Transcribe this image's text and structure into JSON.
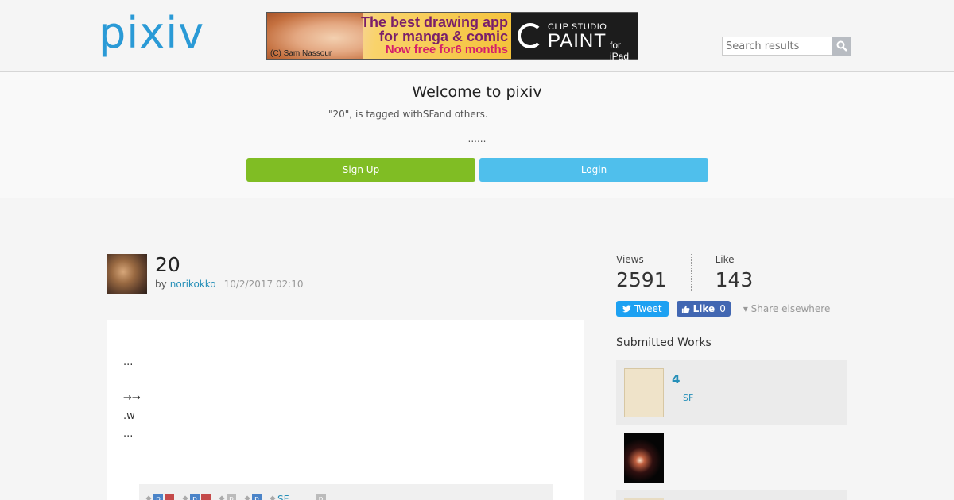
{
  "header": {
    "logo": "pixiv",
    "search": {
      "placeholder": "Search results"
    }
  },
  "ad": {
    "line1": "The best drawing app",
    "line2": "for manga & comic",
    "line3": "Now free for6 months",
    "credit": "(C) Sam Nassour",
    "brand_small": "CLIP STUDIO",
    "brand_big": "PAINT",
    "brand_for": "for iPad"
  },
  "welcome": {
    "title": "Welcome to pixiv",
    "description": "\"20\", is tagged withSFand others.",
    "dots": "......",
    "signup_label": "Sign Up",
    "login_label": "Login"
  },
  "work": {
    "title": "20",
    "by": "by",
    "author": "norikokko",
    "date": "10/2/2017 02:10",
    "caption": [
      "...",
      "",
      "→→",
      ".w",
      "..."
    ],
    "tags": [
      {
        "kind": "pixiv-red"
      },
      {
        "kind": "pixiv-red"
      },
      {
        "kind": "grey"
      },
      {
        "kind": "pixiv"
      },
      {
        "label": "SF"
      },
      {
        "kind": "grey-plain"
      }
    ]
  },
  "stats": {
    "views_label": "Views",
    "views_value": "2591",
    "like_label": "Like",
    "like_value": "143"
  },
  "share": {
    "tweet_label": "Tweet",
    "like_label": "Like",
    "like_count": "0",
    "share_else": "▾ Share elsewhere"
  },
  "submitted": {
    "title": "Submitted Works",
    "items": [
      {
        "count": "4",
        "tag": "SF"
      }
    ]
  },
  "colors": {
    "accent": "#258fb8",
    "logo": "#2a9ad6",
    "signup": "#80bd24",
    "login": "#4fbfec",
    "twitter": "#1da1f2",
    "facebook": "#4267b2"
  }
}
